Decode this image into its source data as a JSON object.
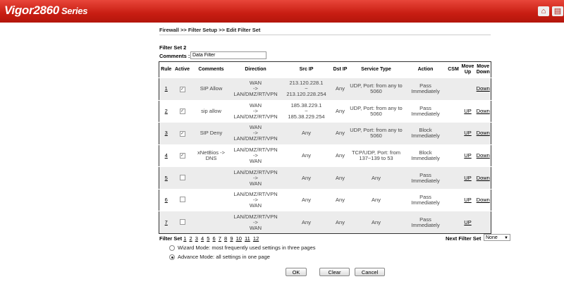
{
  "header": {
    "logo_main": "Vigor2860",
    "logo_series": "Series",
    "icons": [
      "home-icon",
      "menu-icon"
    ]
  },
  "breadcrumb": "Firewall >> Filter Setup >> Edit Filter Set",
  "filter_set_title": "Filter Set 2",
  "comments": {
    "label": "Comments :",
    "value": "Data Filter"
  },
  "table": {
    "headers": {
      "rule": "Rule",
      "active": "Active",
      "comments": "Comments",
      "direction": "Direction",
      "src_ip": "Src IP",
      "dst_ip": "Dst IP",
      "service_type": "Service Type",
      "action": "Action",
      "csm": "CSM",
      "move_up": "Move Up",
      "move_down": "Move Down"
    },
    "rows": [
      {
        "rule": "1",
        "active": true,
        "comments": "SIP Allow",
        "direction": "WAN\n->\nLAN/DMZ/RT/VPN",
        "src_ip": "213.120.228.1\n~\n213.120.228.254",
        "dst_ip": "Any",
        "service_type": "UDP, Port: from any to 5060",
        "action": "Pass Immediately",
        "up": "",
        "down": "Down"
      },
      {
        "rule": "2",
        "active": true,
        "comments": "sip allow",
        "direction": "WAN\n->\nLAN/DMZ/RT/VPN",
        "src_ip": "185.38.229.1\n~\n185.38.229.254",
        "dst_ip": "Any",
        "service_type": "UDP, Port: from any to 5060",
        "action": "Pass Immediately",
        "up": "UP",
        "down": "Down"
      },
      {
        "rule": "3",
        "active": true,
        "comments": "SIP Deny",
        "direction": "WAN\n->\nLAN/DMZ/RT/VPN",
        "src_ip": "Any",
        "dst_ip": "Any",
        "service_type": "UDP, Port: from any to 5060",
        "action": "Block Immediately",
        "up": "UP",
        "down": "Down"
      },
      {
        "rule": "4",
        "active": true,
        "comments": "xNetBios -> DNS",
        "direction": "LAN/DMZ/RT/VPN\n->\nWAN",
        "src_ip": "Any",
        "dst_ip": "Any",
        "service_type": "TCP/UDP, Port: from 137~139 to 53",
        "action": "Block Immediately",
        "up": "UP",
        "down": "Down"
      },
      {
        "rule": "5",
        "active": false,
        "comments": "",
        "direction": "LAN/DMZ/RT/VPN\n->\nWAN",
        "src_ip": "Any",
        "dst_ip": "Any",
        "service_type": "Any",
        "action": "Pass Immediately",
        "up": "UP",
        "down": "Down"
      },
      {
        "rule": "6",
        "active": false,
        "comments": "",
        "direction": "LAN/DMZ/RT/VPN\n->\nWAN",
        "src_ip": "Any",
        "dst_ip": "Any",
        "service_type": "Any",
        "action": "Pass Immediately",
        "up": "UP",
        "down": "Down"
      },
      {
        "rule": "7",
        "active": false,
        "comments": "",
        "direction": "LAN/DMZ/RT/VPN\n->\nWAN",
        "src_ip": "Any",
        "dst_ip": "Any",
        "service_type": "Any",
        "action": "Pass Immediately",
        "up": "UP",
        "down": ""
      }
    ]
  },
  "pager": {
    "label": "Filter Set",
    "pages": [
      "1",
      "2",
      "3",
      "4",
      "5",
      "6",
      "7",
      "8",
      "9",
      "10",
      "11",
      "12"
    ]
  },
  "next_filter_set": {
    "label": "Next Filter Set",
    "selected": "None"
  },
  "modes": {
    "wizard": "Wizard Mode: most frequently used settings in three pages",
    "advance": "Advance Mode: all settings in one page",
    "selected": "advance"
  },
  "buttons": {
    "ok": "OK",
    "clear": "Clear",
    "cancel": "Cancel"
  }
}
